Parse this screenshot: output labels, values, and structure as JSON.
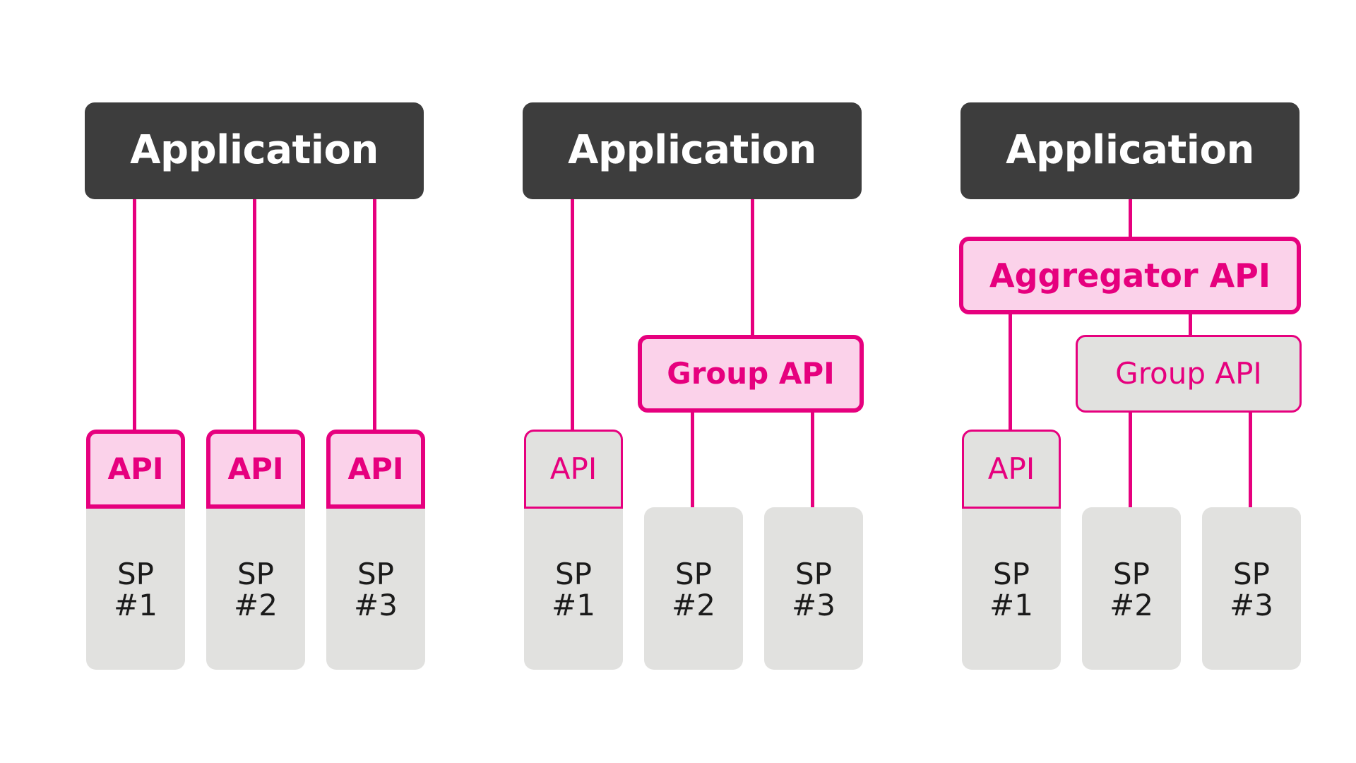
{
  "theme": {
    "background": "#ffffff",
    "app_fill": "#3d3d3d",
    "app_text": "#ffffff",
    "accent": "#e6007e",
    "accent_fill": "#fbd2ea",
    "neutral_fill": "#e1e1df",
    "neutral_text": "#1b1b1b"
  },
  "diagram": {
    "type": "architecture-pattern-comparison",
    "panel_count": 3
  },
  "panels": [
    {
      "id": "panel-direct",
      "application_label": "Application",
      "nodes": [
        {
          "id": "p1-api-1",
          "label": "API",
          "style": "strong",
          "shape": "chip"
        },
        {
          "id": "p1-api-2",
          "label": "API",
          "style": "strong",
          "shape": "chip"
        },
        {
          "id": "p1-api-3",
          "label": "API",
          "style": "strong",
          "shape": "chip"
        },
        {
          "id": "p1-sp-1",
          "label": "SP\n#1",
          "style": "neutral"
        },
        {
          "id": "p1-sp-2",
          "label": "SP\n#2",
          "style": "neutral"
        },
        {
          "id": "p1-sp-3",
          "label": "SP\n#3",
          "style": "neutral"
        }
      ]
    },
    {
      "id": "panel-group",
      "application_label": "Application",
      "nodes": [
        {
          "id": "p2-api-1",
          "label": "API",
          "style": "muted",
          "shape": "chip"
        },
        {
          "id": "p2-group",
          "label": "Group API",
          "style": "strong",
          "shape": "float"
        },
        {
          "id": "p2-sp-1",
          "label": "SP\n#1",
          "style": "neutral"
        },
        {
          "id": "p2-sp-2",
          "label": "SP\n#2",
          "style": "neutral"
        },
        {
          "id": "p2-sp-3",
          "label": "SP\n#3",
          "style": "neutral"
        }
      ]
    },
    {
      "id": "panel-aggregator",
      "application_label": "Application",
      "nodes": [
        {
          "id": "p3-aggregator",
          "label": "Aggregator API",
          "style": "strong",
          "shape": "float"
        },
        {
          "id": "p3-api-1",
          "label": "API",
          "style": "muted",
          "shape": "chip"
        },
        {
          "id": "p3-group",
          "label": "Group API",
          "style": "muted",
          "shape": "float"
        },
        {
          "id": "p3-sp-1",
          "label": "SP\n#1",
          "style": "neutral"
        },
        {
          "id": "p3-sp-2",
          "label": "SP\n#2",
          "style": "neutral"
        },
        {
          "id": "p3-sp-3",
          "label": "SP\n#3",
          "style": "neutral"
        }
      ]
    }
  ],
  "labels": {
    "application": "Application",
    "api": "API",
    "group_api": "Group API",
    "aggregator_api": "Aggregator API",
    "sp_1": "SP\n#1",
    "sp_2": "SP\n#2",
    "sp_3": "SP\n#3"
  }
}
